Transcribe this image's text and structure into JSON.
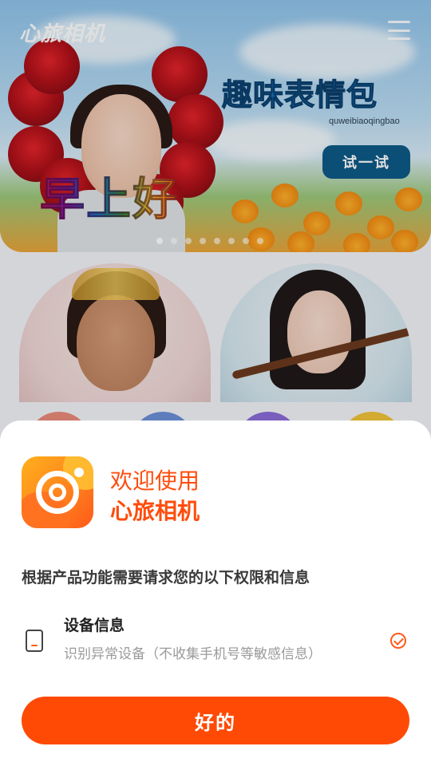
{
  "app": {
    "logo_text": "心旅相机"
  },
  "banner": {
    "title": "趣味表情包",
    "subtitle": "quweibiaoqingbao",
    "try_label": "试一试",
    "greeting": "早上好",
    "slide_count": 8,
    "active_slide": 0
  },
  "dialog": {
    "welcome": "欢迎使用",
    "app_name": "心旅相机",
    "intro": "根据产品功能需要请求您的以下权限和信息",
    "permission": {
      "title": "设备信息",
      "description": "识别异常设备（不收集手机号等敏感信息）",
      "checked": true
    },
    "ok_label": "好的"
  },
  "colors": {
    "accent": "#ff4a06",
    "banner_button": "#0e5a87",
    "banner_title": "#0f6ab5"
  },
  "icons": {
    "menu": "menu-icon",
    "device": "device-icon",
    "check": "check-circle-icon",
    "app": "camera-lens-icon"
  }
}
